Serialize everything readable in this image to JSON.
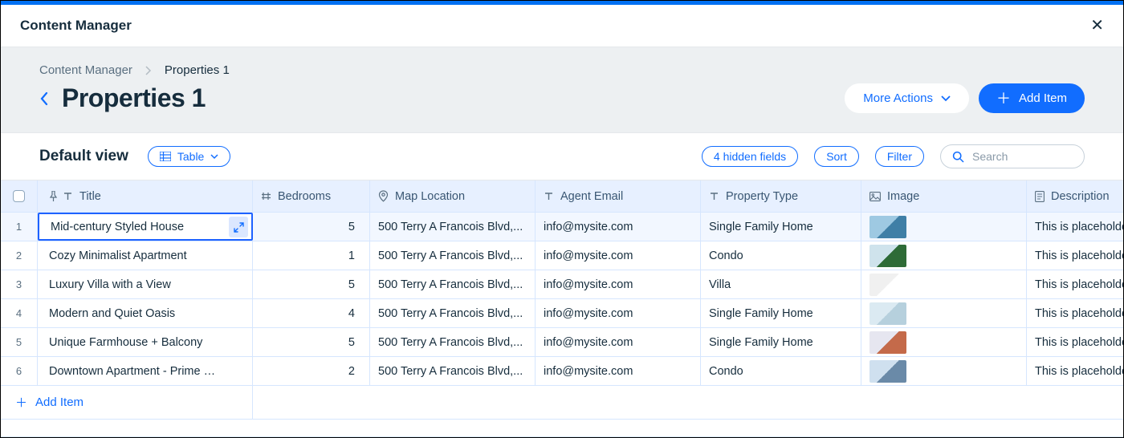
{
  "titlebar": {
    "title": "Content Manager"
  },
  "breadcrumbs": {
    "root": "Content Manager",
    "current": "Properties 1"
  },
  "page_title": "Properties 1",
  "actions": {
    "more": "More Actions",
    "add": "Add Item"
  },
  "viewbar": {
    "view_name": "Default view",
    "table_label": "Table",
    "hidden_fields": "4 hidden fields",
    "sort": "Sort",
    "filter": "Filter",
    "search_placeholder": "Search"
  },
  "columns": {
    "title": "Title",
    "bedrooms": "Bedrooms",
    "map": "Map Location",
    "email": "Agent Email",
    "type": "Property Type",
    "image": "Image",
    "desc": "Description"
  },
  "rows": [
    {
      "n": "1",
      "title": "Mid-century Styled House",
      "bedrooms": "5",
      "map": "500 Terry A Francois Blvd,...",
      "email": "info@mysite.com",
      "type": "Single Family Home",
      "img": "#9ec9e2,#3f7fa6",
      "desc": "This is placeholde"
    },
    {
      "n": "2",
      "title": "Cozy Minimalist Apartment",
      "bedrooms": "1",
      "map": "500 Terry A Francois Blvd,...",
      "email": "info@mysite.com",
      "type": "Condo",
      "img": "#cfe3ec,#2e6b37",
      "desc": "This is placeholde"
    },
    {
      "n": "3",
      "title": "Luxury Villa with a View",
      "bedrooms": "5",
      "map": "500 Terry A Francois Blvd,...",
      "email": "info@mysite.com",
      "type": "Villa",
      "img": "#f0f0f0,#ffffff",
      "desc": "This is placeholde"
    },
    {
      "n": "4",
      "title": "Modern and Quiet Oasis",
      "bedrooms": "4",
      "map": "500 Terry A Francois Blvd,...",
      "email": "info@mysite.com",
      "type": "Single Family Home",
      "img": "#dbeaf2,#b6d0dd",
      "desc": "This is placeholde"
    },
    {
      "n": "5",
      "title": "Unique Farmhouse + Balcony",
      "bedrooms": "5",
      "map": "500 Terry A Francois Blvd,...",
      "email": "info@mysite.com",
      "type": "Single Family Home",
      "img": "#e6e6f0,#c46a4a",
      "desc": "This is placeholde"
    },
    {
      "n": "6",
      "title": "Downtown Apartment - Prime …",
      "bedrooms": "2",
      "map": "500 Terry A Francois Blvd,...",
      "email": "info@mysite.com",
      "type": "Condo",
      "img": "#cfe0ef,#6a8aa8",
      "desc": "This is placeholde"
    }
  ],
  "add_item_label": "Add Item"
}
